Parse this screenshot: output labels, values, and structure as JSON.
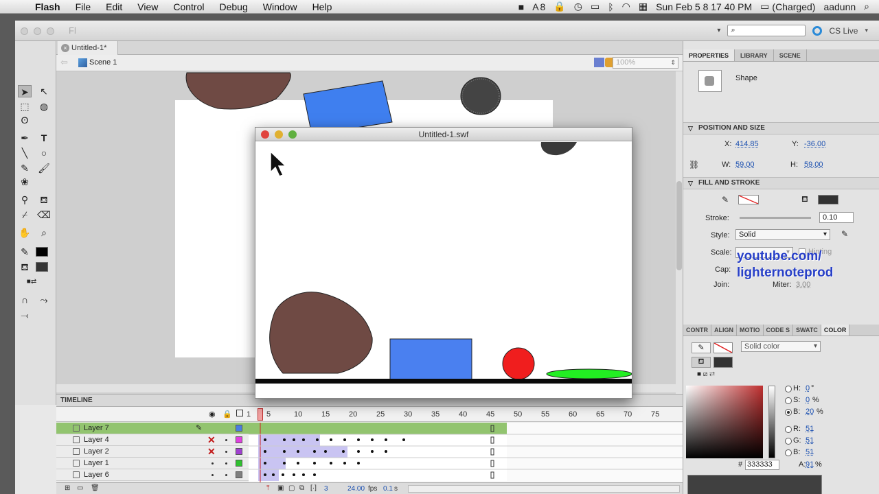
{
  "menubar": {
    "apple": "",
    "items": [
      "Flash",
      "File",
      "Edit",
      "View",
      "Control",
      "Debug",
      "Window",
      "Help"
    ],
    "status": {
      "ai_count": "8",
      "datetime": "Sun Feb 5  8 17 40 PM",
      "battery": "(Charged)",
      "user": "aadunn"
    }
  },
  "titlebar": {
    "app_logo": "Fl",
    "cs_live": "CS Live"
  },
  "document": {
    "tab_title": "Untitled-1*",
    "scene": "Scene 1",
    "zoom": "100%"
  },
  "swf_window": {
    "title": "Untitled-1.swf"
  },
  "timeline": {
    "title": "TIMELINE",
    "ruler": [
      "1",
      "5",
      "10",
      "15",
      "20",
      "25",
      "30",
      "35",
      "40",
      "45",
      "50",
      "55",
      "60",
      "65",
      "70",
      "75"
    ],
    "layers": [
      {
        "name": "Layer 7",
        "selected": true,
        "color": "#4a7ee0"
      },
      {
        "name": "Layer 4",
        "selected": false,
        "color": "#e040e0"
      },
      {
        "name": "Layer 2",
        "selected": false,
        "color": "#a040d0"
      },
      {
        "name": "Layer 1",
        "selected": false,
        "color": "#30c030"
      },
      {
        "name": "Layer 6",
        "selected": false,
        "color": "#808080"
      }
    ],
    "footer": {
      "frame": "3",
      "fps": "24.00",
      "fps_label": "fps",
      "time": "0.1",
      "time_unit": "s"
    }
  },
  "properties": {
    "tabs": [
      "PROPERTIES",
      "LIBRARY",
      "SCENE"
    ],
    "object_type": "Shape",
    "position_section": "POSITION AND SIZE",
    "x_label": "X:",
    "x": "414.85",
    "y_label": "Y:",
    "y": "-36.00",
    "w_label": "W:",
    "w": "59.00",
    "h_label": "H:",
    "h": "59.00",
    "fill_section": "FILL AND STROKE",
    "stroke_label": "Stroke:",
    "stroke": "0.10",
    "style_label": "Style:",
    "style": "Solid",
    "scale_label": "Scale:",
    "hinting": "Hinting",
    "cap_label": "Cap:",
    "join_label": "Join:",
    "miter_label": "Miter:",
    "miter": "3.00"
  },
  "watermark": [
    "youtube.com/",
    "lighternoteprod"
  ],
  "color_panel": {
    "tabs": [
      "CONTR",
      "ALIGN",
      "MOTIO",
      "CODE S",
      "SWATC",
      "COLOR"
    ],
    "fill_type": "Solid color",
    "h_label": "H:",
    "h": "0",
    "h_unit": "°",
    "s_label": "S:",
    "s": "0",
    "s_unit": "%",
    "b_label": "B:",
    "b": "20",
    "b_unit": "%",
    "r_label": "R:",
    "r": "51",
    "g_label": "G:",
    "g": "51",
    "bl_label": "B:",
    "bl": "51",
    "hex_prefix": "#",
    "hex": "333333",
    "alpha_label": "A:",
    "alpha": "91",
    "alpha_unit": "%"
  }
}
